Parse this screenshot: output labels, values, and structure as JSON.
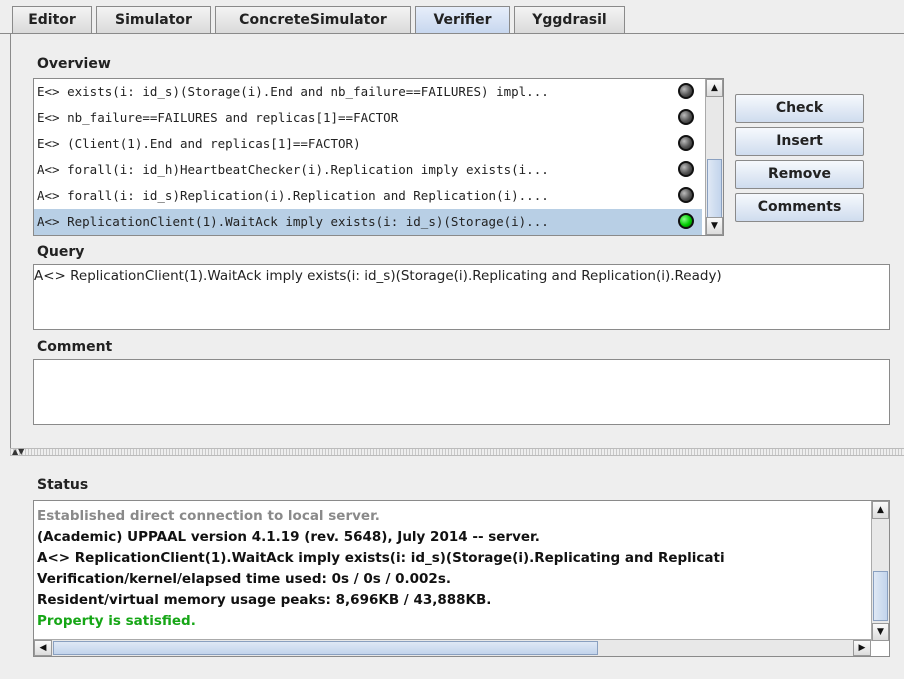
{
  "tabs": [
    {
      "label": "Editor",
      "active": false
    },
    {
      "label": "Simulator",
      "active": false
    },
    {
      "label": "ConcreteSimulator",
      "active": false
    },
    {
      "label": "Verifier",
      "active": true
    },
    {
      "label": "Yggdrasil",
      "active": false
    }
  ],
  "overview": {
    "label": "Overview",
    "items": [
      {
        "text": "E<> exists(i: id_s)(Storage(i).End and nb_failure==FAILURES) impl...",
        "status": "unknown"
      },
      {
        "text": "E<> nb_failure==FAILURES and replicas[1]==FACTOR",
        "status": "unknown"
      },
      {
        "text": "E<> (Client(1).End and replicas[1]==FACTOR)",
        "status": "unknown"
      },
      {
        "text": "A<> forall(i: id_h)HeartbeatChecker(i).Replication imply exists(i...",
        "status": "unknown"
      },
      {
        "text": "A<> forall(i: id_s)Replication(i).Replication and Replication(i)....",
        "status": "unknown"
      },
      {
        "text": "A<> ReplicationClient(1).WaitAck imply exists(i: id_s)(Storage(i)...",
        "status": "satisfied",
        "selected": true
      }
    ]
  },
  "buttons": {
    "check": "Check",
    "insert": "Insert",
    "remove": "Remove",
    "comments": "Comments"
  },
  "query": {
    "label": "Query",
    "value": "A<> ReplicationClient(1).WaitAck imply exists(i: id_s)(Storage(i).Replicating and Replication(i).Ready)"
  },
  "comment": {
    "label": "Comment",
    "value": ""
  },
  "status": {
    "label": "Status",
    "lines": [
      {
        "text": "Established direct connection to local server.",
        "color": "#8a8a8a"
      },
      {
        "text": "(Academic) UPPAAL version 4.1.19 (rev. 5648), July 2014 -- server.",
        "color": "#111111"
      },
      {
        "text": "A<> ReplicationClient(1).WaitAck imply exists(i: id_s)(Storage(i).Replicating and Replicati",
        "color": "#111111"
      },
      {
        "text": "Verification/kernel/elapsed time used: 0s / 0s / 0.002s.",
        "color": "#111111"
      },
      {
        "text": "Resident/virtual memory usage peaks: 8,696KB / 43,888KB.",
        "color": "#111111"
      },
      {
        "text": "Property is satisfied.",
        "color": "#16a616"
      }
    ]
  },
  "colors": {
    "selection": "#b8cfe5",
    "satisfied": "#00cc00",
    "satisfied_text": "#16a616"
  }
}
